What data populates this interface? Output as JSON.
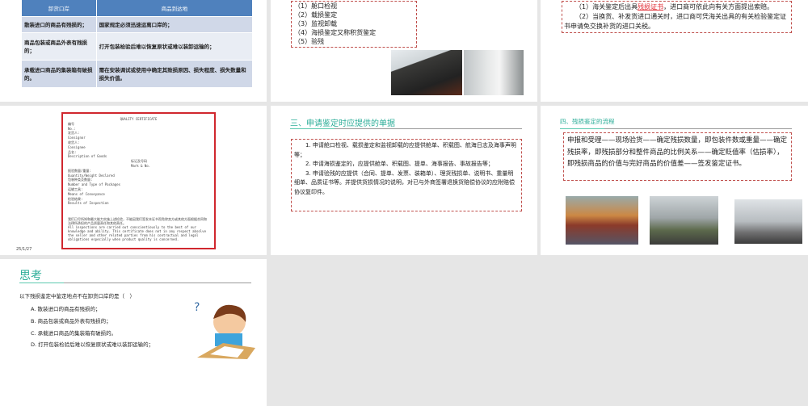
{
  "slide1": {
    "headers": [
      "卸货口岸",
      "商品到达地"
    ],
    "rows": [
      [
        "散装进口的商品有残损的；",
        "国家规定必须迅速运离口岸的；"
      ],
      [
        "商品包装或商品外表有残损的；",
        "打开包装检验后难以恢复原状或难以装卸运输的；"
      ],
      [
        "承载进口商品的集装箱有破损的。",
        "需在安装调试或使用中确定其致损原因、损失程度、损失数量和损失价值。"
      ]
    ]
  },
  "slide2": {
    "items": [
      "（1）舱口检视",
      "（2）载损鉴定",
      "（3）监视卸载",
      "（4）海损鉴定又称积货鉴定",
      "（5）验残"
    ]
  },
  "slide3": {
    "line1_pre": "（1）海关鉴定后出具",
    "line1_red": "残损证书",
    "line1_post": "，进口商可依此向有关方面提出索赔。",
    "line2": "（2）当换货、补发货进口通关时，进口商可凭海关出具的有关检验鉴定证书申请免交换补货的进口关税。"
  },
  "slide4": {
    "cert_title": "QUALITY CERTIFICATE",
    "fields": [
      "编号",
      "No.:",
      "发货人:",
      "Consignor",
      "收货人:",
      "Consignee",
      "品名:",
      "Description of Goods"
    ],
    "mark_cn": "标记及号码",
    "mark_en": "Mark & No.",
    "fields2": [
      "报验数量/重量:",
      "Quantity/Weight Declared",
      "包装种类及数量:",
      "Number and Type of Packages",
      "运输工具:",
      "Means of Conveyance",
      "检验结果:",
      "Results of Inspection"
    ],
    "statement_cn": "我们已尽所知和最大能力实施上述检验，不能因我们签发本证书而免除卖方或其他方面根据合同和法律所承担的产品质量责任和其他责任。",
    "statement_en": "All inspections are carried out conscientiously to the best of our knowledge and ability. This certificate does not in any respect absolve the seller and other related parties from his contractual and legal obligations especially when product quality is concerned.",
    "date": "25/1/27"
  },
  "slide5": {
    "title": "三、申请鉴定时应提供的单据",
    "paras": [
      "1. 申请舱口检视、载损鉴定和监视卸载的应提供舱单、积载图、航海日志及海事声明等；",
      "2. 申请海损鉴定的，应提供舱单、积载图、提单、海事报告、事故报告等；",
      "3. 申请验残的应提供（合同、提单、发票、装箱单）、理货残损单、说明书、重量明细单、品质证书等。并提供货损情况的说明，对已与外商签署退换货赔偿协议的应附赔偿协议复印件。"
    ]
  },
  "slide6": {
    "title": "四、残损鉴定的流程",
    "body": "申报和受理——现场验货——确定残损数量，即包装件数或重量——确定残损率，即残损部分和整件商品的比例关系——确定贬值率（估损率），即残损商品的价值与完好商品的价值差——签发鉴定证书。"
  },
  "slide7": {
    "title": "思考",
    "question": "以下残损鉴定中鉴定地点不在卸货口岸的是（　）",
    "options": [
      "A. 散装进口的商品有残损的；",
      "B. 商品包装或商品外表有残损的；",
      "C. 承载进口商品的集装箱有破损的。",
      "D. 打开包装检验后难以恢复原状或难以装卸运输的；"
    ]
  }
}
